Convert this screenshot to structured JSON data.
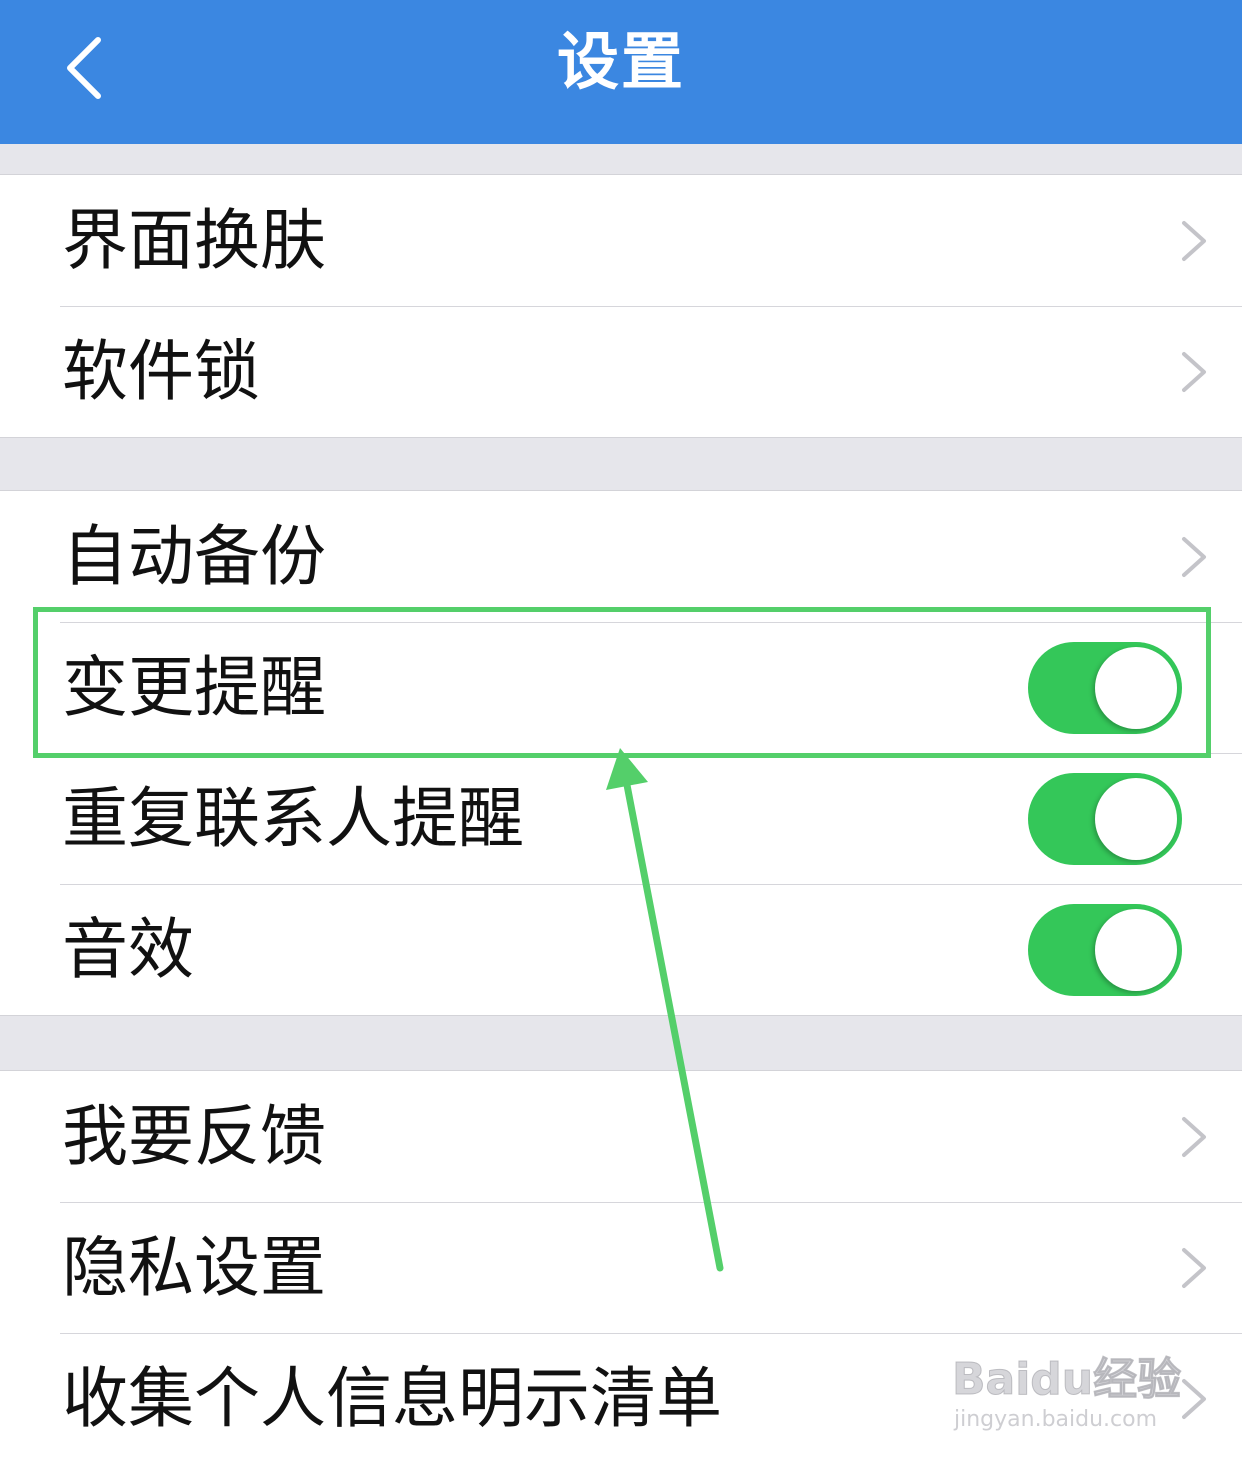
{
  "navbar": {
    "title": "设置",
    "back_icon": "chevron-left-icon",
    "background": "#3b87e1"
  },
  "groups": [
    {
      "items": [
        {
          "label": "界面换肤",
          "control": "chevron"
        },
        {
          "label": "软件锁",
          "control": "chevron"
        }
      ]
    },
    {
      "items": [
        {
          "label": "自动备份",
          "control": "chevron"
        },
        {
          "label": "变更提醒",
          "control": "toggle",
          "on": true
        },
        {
          "label": "重复联系人提醒",
          "control": "toggle",
          "on": true
        },
        {
          "label": "音效",
          "control": "toggle",
          "on": true
        }
      ]
    },
    {
      "items": [
        {
          "label": "我要反馈",
          "control": "chevron"
        },
        {
          "label": "隐私设置",
          "control": "chevron"
        },
        {
          "label": "收集个人信息明示清单",
          "control": "chevron"
        }
      ]
    }
  ],
  "colors": {
    "toggle_on": "#34c759",
    "annotation": "#54cf6a"
  },
  "watermark": {
    "logo": "Baidu经验",
    "url": "jingyan.baidu.com"
  }
}
